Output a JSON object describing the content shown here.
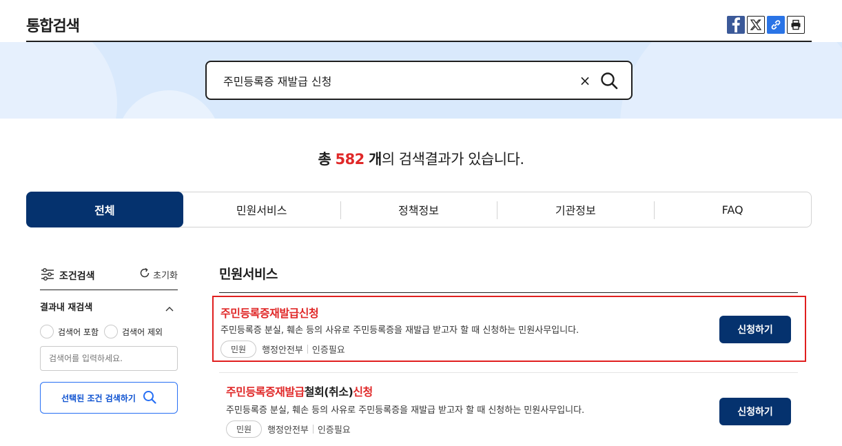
{
  "header": {
    "title": "통합검색"
  },
  "share": {
    "facebook": "facebook-icon",
    "x": "x-icon",
    "link": "link-icon",
    "print": "print-icon"
  },
  "search": {
    "value": "주민등록증 재발급 신청",
    "clear_label": "×"
  },
  "summary": {
    "prefix": "총",
    "count": "582",
    "unit": "개",
    "suffix": "의 검색결과가 있습니다."
  },
  "tabs": [
    {
      "label": "전체",
      "active": true
    },
    {
      "label": "민원서비스"
    },
    {
      "label": "정책정보"
    },
    {
      "label": "기관정보"
    },
    {
      "label": "FAQ"
    }
  ],
  "filter": {
    "title": "조건검색",
    "reset_label": "초기화",
    "sub_title": "결과내 재검색",
    "include_label": "검색어 포함",
    "exclude_label": "검색어 제외",
    "keyword_placeholder": "검색어를 입력하세요.",
    "apply_label": "선택된 조건 검색하기"
  },
  "section": {
    "title": "민원서비스",
    "results": [
      {
        "title": "주민등록증재발급신청",
        "description": "주민등록증 분실, 훼손 등의 사유로 주민등록증을 재발급 받고자 할 때 신청하는 민원사무입니다.",
        "tag": "민원",
        "agency": "행정안전부",
        "auth": "인증필요",
        "button": "신청하기"
      },
      {
        "title_part1": "주민등록증재발급",
        "title_part2": "철회(취소)",
        "title_part3": "신청",
        "description": "주민등록증 분실, 훼손 등의 사유로 주민등록증을 재발급 받고자 할 때 신청하는 민원사무입니다.",
        "tag": "민원",
        "agency": "행정안전부",
        "auth": "인증필요",
        "button": "신청하기"
      }
    ]
  },
  "colors": {
    "primary": "#05326e",
    "accent_red": "#e02828",
    "band": "#d9e9fc",
    "link_blue": "#256ef4"
  }
}
